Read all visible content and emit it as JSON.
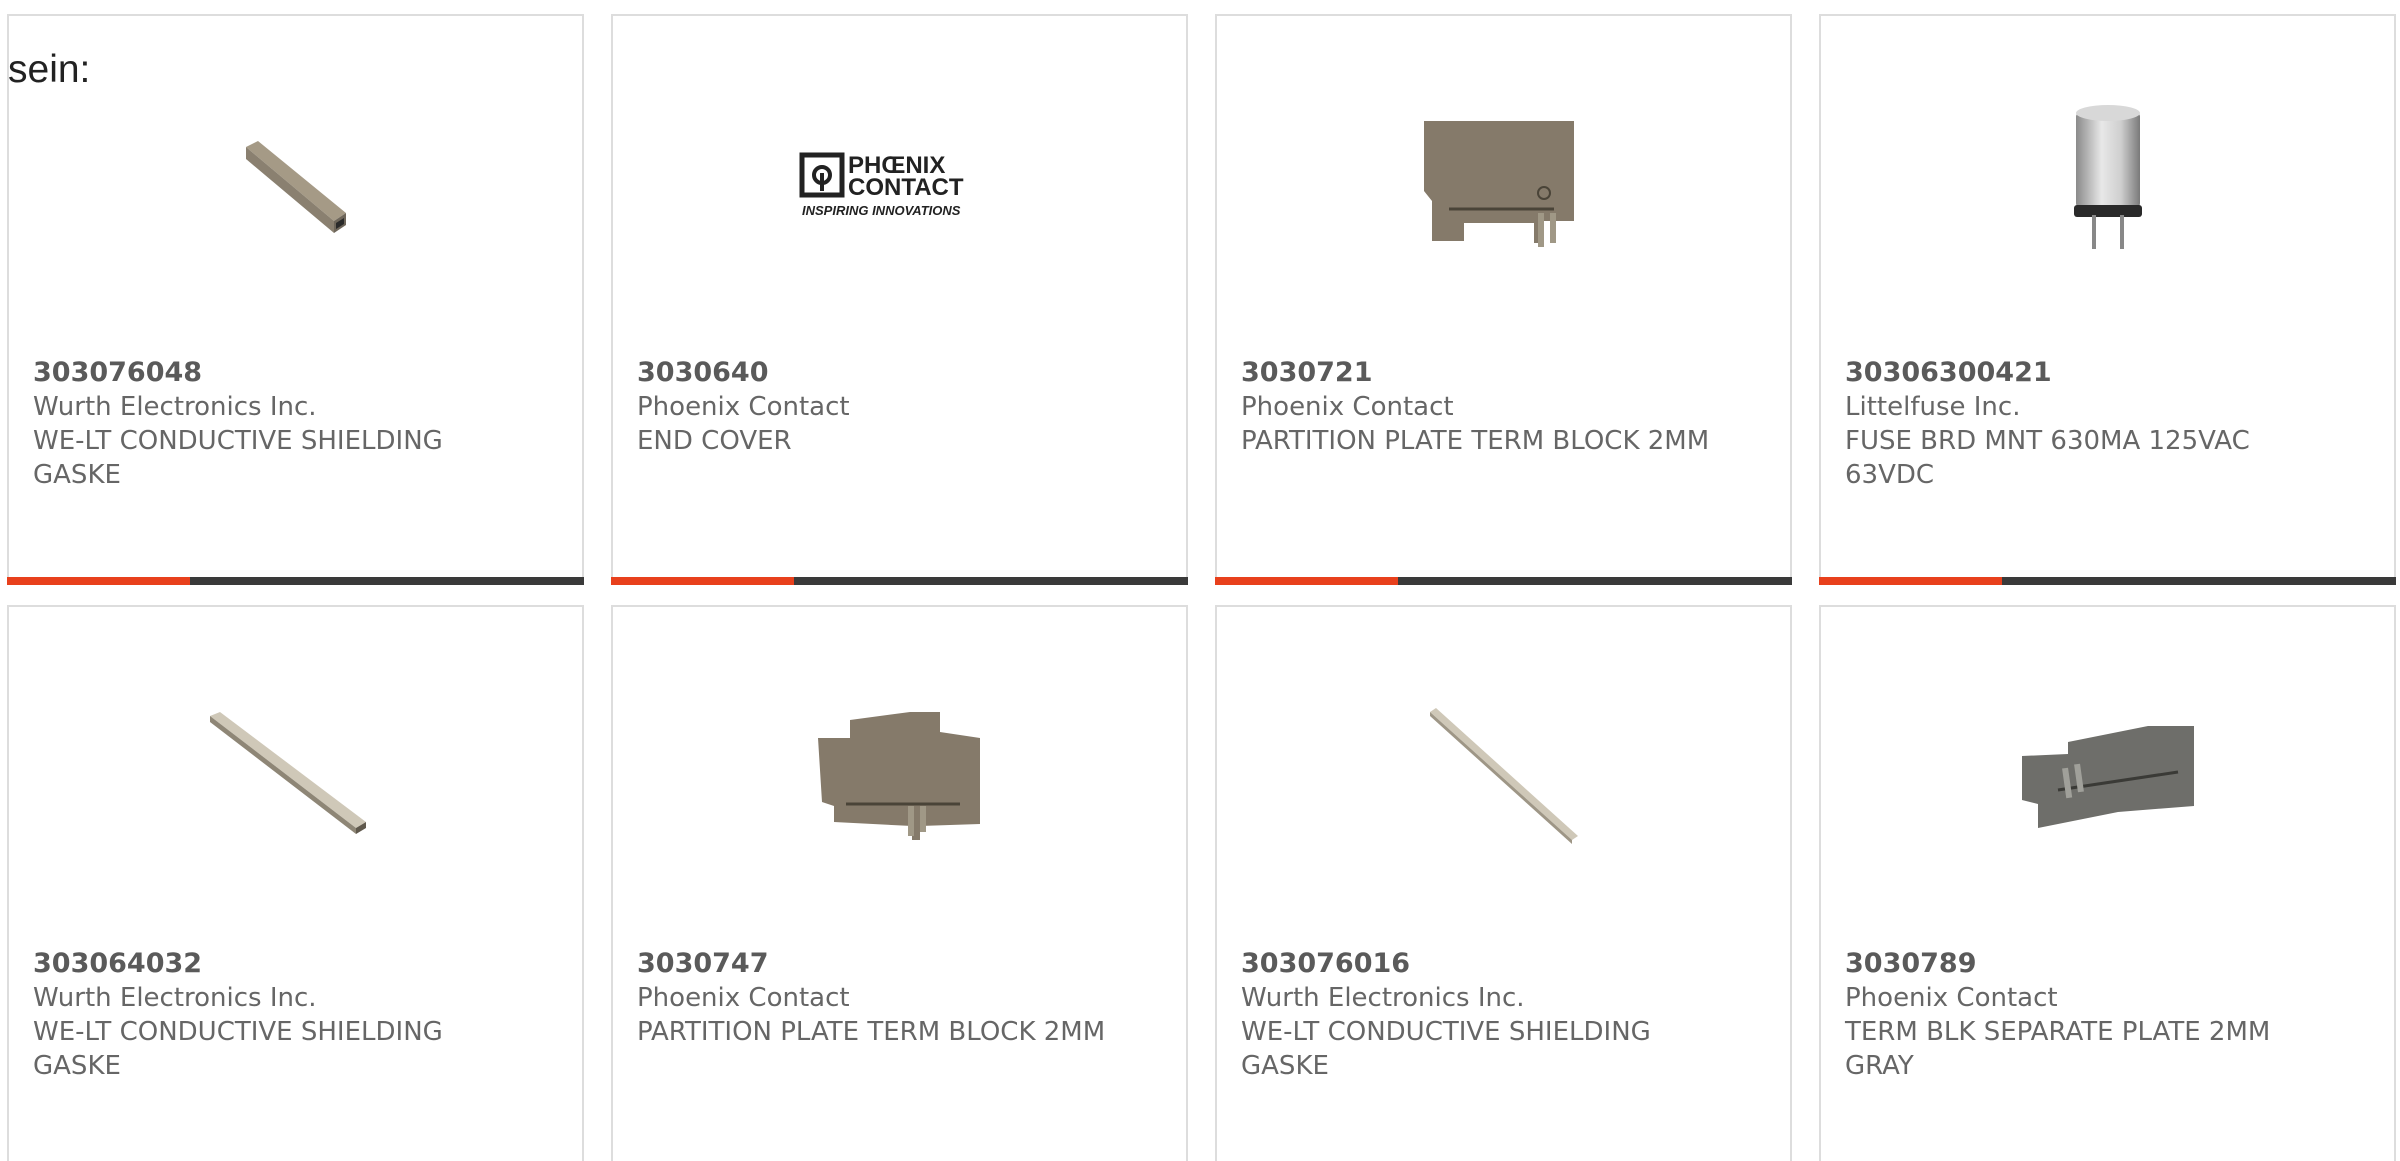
{
  "intro_text": "sein:",
  "products": [
    {
      "part_number": "303076048",
      "manufacturer": "Wurth Electronics Inc.",
      "description": "WE-LT CONDUCTIVE SHIELDING GASKE",
      "icon": "shielding-gasket-icon"
    },
    {
      "part_number": "3030640",
      "manufacturer": "Phoenix Contact",
      "description": "END COVER",
      "icon": "phoenix-contact-logo",
      "logo": {
        "line1": "PHŒNIX",
        "line2": "CONTACT",
        "tagline": "INSPIRING INNOVATIONS"
      }
    },
    {
      "part_number": "3030721",
      "manufacturer": "Phoenix Contact",
      "description": "PARTITION PLATE TERM BLOCK 2MM",
      "icon": "partition-plate-icon"
    },
    {
      "part_number": "30306300421",
      "manufacturer": "Littelfuse Inc.",
      "description": "FUSE BRD MNT 630MA 125VAC 63VDC",
      "icon": "fuse-icon"
    },
    {
      "part_number": "303064032",
      "manufacturer": "Wurth Electronics Inc.",
      "description": "WE-LT CONDUCTIVE SHIELDING GASKE",
      "icon": "shielding-gasket-icon"
    },
    {
      "part_number": "3030747",
      "manufacturer": "Phoenix Contact",
      "description": "PARTITION PLATE TERM BLOCK 2MM",
      "icon": "partition-plate-icon"
    },
    {
      "part_number": "303076016",
      "manufacturer": "Wurth Electronics Inc.",
      "description": "WE-LT CONDUCTIVE SHIELDING GASKE",
      "icon": "shielding-gasket-icon"
    },
    {
      "part_number": "3030789",
      "manufacturer": "Phoenix Contact",
      "description": "TERM BLK SEPARATE PLATE 2MM GRAY",
      "icon": "separate-plate-icon"
    }
  ],
  "colors": {
    "accent_red": "#e8401c",
    "accent_dark": "#3a3a3a",
    "text_gray": "#666666",
    "card_border": "#dddddd"
  }
}
